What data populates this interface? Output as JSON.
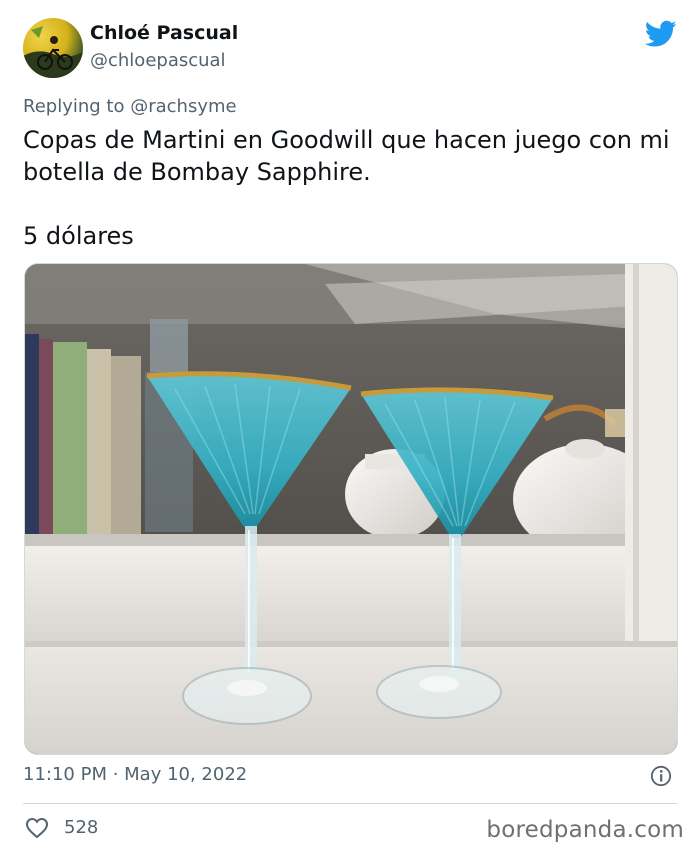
{
  "tweet": {
    "author": {
      "display_name": "Chloé Pascual",
      "handle": "@chloepascual"
    },
    "replying": {
      "prefix": "Replying to",
      "mention": "@rachsyme"
    },
    "text_lines": [
      "Copas de Martini en Goodwill que hacen juego con mi",
      "botella de Bombay Sapphire."
    ],
    "text_price": "5 dólares",
    "timestamp": "11:10 PM · May 10, 2022",
    "likes": "528",
    "brand_color": "#1d9bf0"
  },
  "icons": {
    "brand": "twitter-bird-icon",
    "info": "info-icon",
    "like": "heart-icon"
  },
  "watermark": "boredpanda.com"
}
